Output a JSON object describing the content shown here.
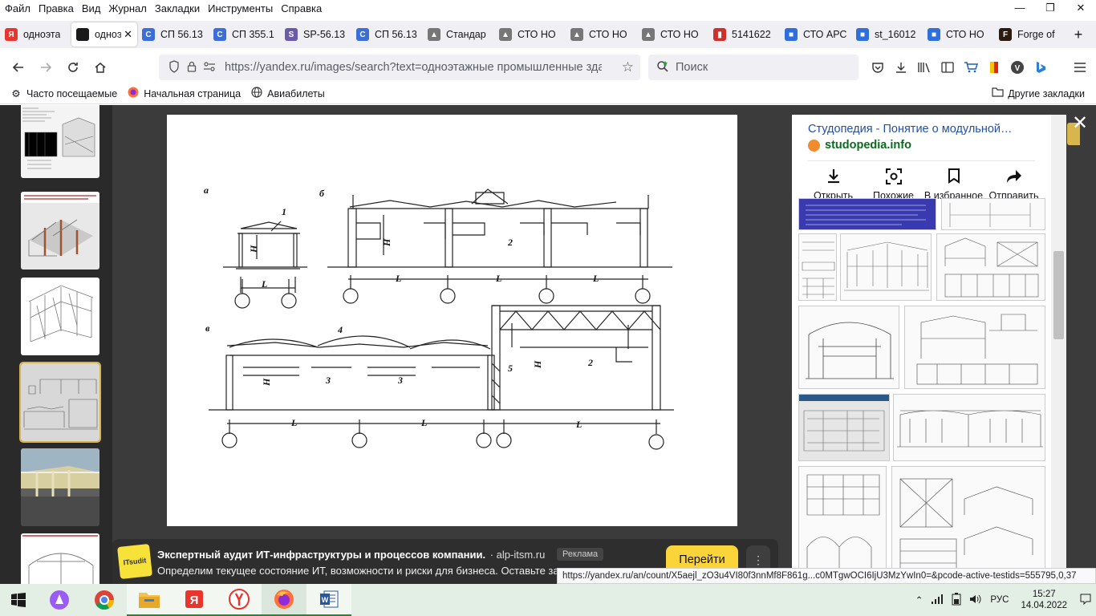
{
  "menu": [
    "Файл",
    "Правка",
    "Вид",
    "Журнал",
    "Закладки",
    "Инструменты",
    "Справка"
  ],
  "window_controls": [
    "—",
    "❐",
    "✕"
  ],
  "tabs": [
    {
      "label": "одноэта",
      "icon": "yandex-icon",
      "color": "#e8352d",
      "letter": "Я"
    },
    {
      "label": "одноэ",
      "icon": "image-icon",
      "color": "#1a1a1a",
      "letter": "",
      "active": true
    },
    {
      "label": "СП 56.13",
      "icon": "refresh-doc-icon",
      "color": "#3b6ed6",
      "letter": "C"
    },
    {
      "label": "СП 355.1",
      "icon": "refresh-doc-icon",
      "color": "#3b6ed6",
      "letter": "C"
    },
    {
      "label": "SP-56.13",
      "icon": "shield-icon",
      "color": "#6a5aa8",
      "letter": "S"
    },
    {
      "label": "СП 56.13",
      "icon": "refresh-doc-icon",
      "color": "#3b6ed6",
      "letter": "C"
    },
    {
      "label": "Стандар",
      "icon": "building-icon",
      "color": "#777777",
      "letter": "▲"
    },
    {
      "label": "СТО НО",
      "icon": "building-icon",
      "color": "#777777",
      "letter": "▲"
    },
    {
      "label": "СТО НО",
      "icon": "building-icon",
      "color": "#777777",
      "letter": "▲"
    },
    {
      "label": "СТО НО",
      "icon": "building-icon",
      "color": "#777777",
      "letter": "▲"
    },
    {
      "label": "5141622",
      "icon": "pdf-icon",
      "color": "#d0302c",
      "letter": "▮"
    },
    {
      "label": "СТО АРС",
      "icon": "cube-icon",
      "color": "#2f6fdc",
      "letter": "■"
    },
    {
      "label": "st_16012",
      "icon": "cube-icon",
      "color": "#2f6fdc",
      "letter": "■"
    },
    {
      "label": "СТО НО",
      "icon": "cube-icon",
      "color": "#2f6fdc",
      "letter": "■"
    },
    {
      "label": "Forge of",
      "icon": "forge-icon",
      "color": "#2b1a10",
      "letter": "F"
    }
  ],
  "new_tab": "+",
  "nav": {
    "url": "https://yandex.ru/images/search?text=одноэтажные промышленные здания",
    "search_placeholder": "Поиск"
  },
  "bookmarks": [
    "Часто посещаемые",
    "Начальная страница",
    "Авиабилеты"
  ],
  "bookmarks_other": "Другие закладки",
  "drawing_labels": {
    "a": "а",
    "b": "б",
    "v": "в",
    "n1": "1",
    "n2": "2",
    "n3": "3",
    "n4": "4",
    "n5": "5",
    "H": "H",
    "L": "L"
  },
  "side_panel": {
    "title": "Студопедия - Понятие о модульной…",
    "site": "studopedia.info",
    "actions": [
      "Открыть",
      "Похожие",
      "В избранное",
      "Отправить"
    ]
  },
  "ad": {
    "title": "Экспертный аудит ИТ-инфраструктуры и процессов компании.",
    "domain": "· alp-itsm.ru",
    "badge": "Реклама",
    "text": "Определим текущее состояние ИТ, возможности и риски для бизнеса. Оставьте за",
    "cta": "Перейти",
    "more": "⋮",
    "logo_text": "ITsudit"
  },
  "status_url": "https://yandex.ru/an/count/X5aejl_zO3u4VI80f3nnMf8F861g...c0MTgwOCI6IjU3MzYwIn0=&pcode-active-testids=555795,0,37",
  "taskbar": {
    "lang": "РУС",
    "time": "15:27",
    "date": "14.04.2022"
  }
}
